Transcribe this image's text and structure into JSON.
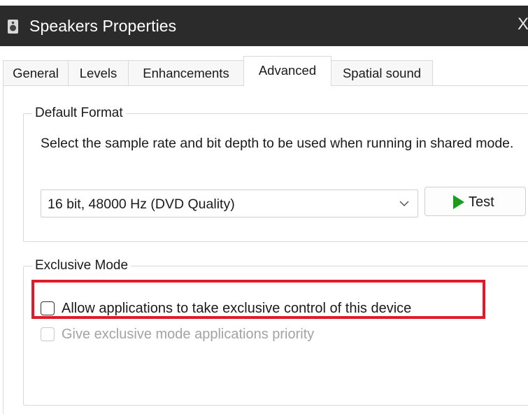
{
  "window": {
    "title": "Speakers Properties",
    "close_glyph": "X",
    "icon": "speaker-icon"
  },
  "tabs": [
    {
      "label": "General",
      "active": false
    },
    {
      "label": "Levels",
      "active": false
    },
    {
      "label": "Enhancements",
      "active": false
    },
    {
      "label": "Advanced",
      "active": true
    },
    {
      "label": "Spatial sound",
      "active": false
    }
  ],
  "default_format": {
    "legend": "Default Format",
    "description": "Select the sample rate and bit depth to be used when running in shared mode.",
    "selected_format": "16 bit, 48000 Hz (DVD Quality)",
    "test_label": "Test",
    "play_icon_color": "#1e9a1e"
  },
  "exclusive_mode": {
    "legend": "Exclusive Mode",
    "allow_exclusive_label": "Allow applications to take exclusive control of this device",
    "allow_exclusive_checked": false,
    "priority_label": "Give exclusive mode applications priority",
    "priority_checked": false,
    "priority_enabled": false
  },
  "highlight_color": "#e11a2a"
}
